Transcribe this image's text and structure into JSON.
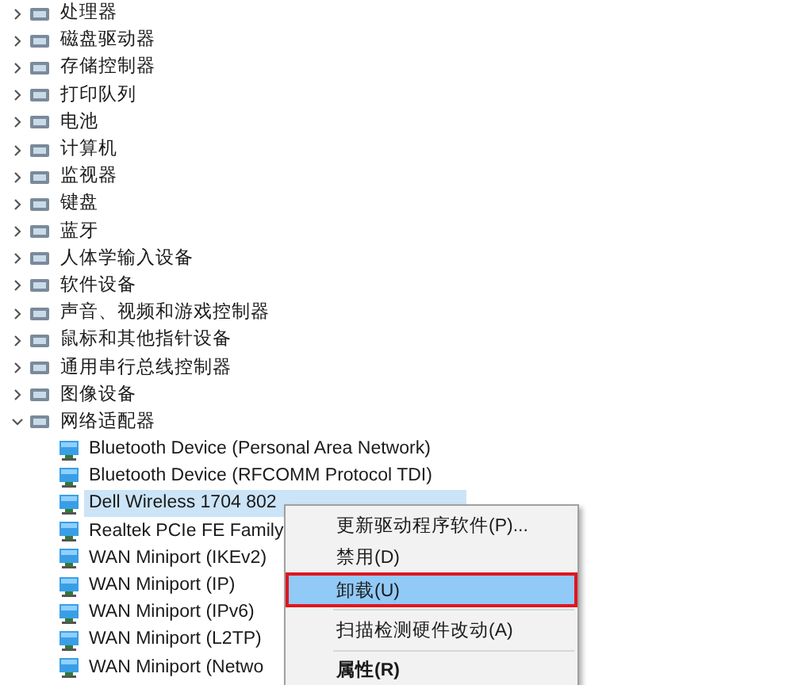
{
  "tree": [
    {
      "label": "处理器",
      "expanded": false
    },
    {
      "label": "磁盘驱动器",
      "expanded": false
    },
    {
      "label": "存储控制器",
      "expanded": false
    },
    {
      "label": "打印队列",
      "expanded": false
    },
    {
      "label": "电池",
      "expanded": false
    },
    {
      "label": "计算机",
      "expanded": false
    },
    {
      "label": "监视器",
      "expanded": false
    },
    {
      "label": "键盘",
      "expanded": false
    },
    {
      "label": "蓝牙",
      "expanded": false
    },
    {
      "label": "人体学输入设备",
      "expanded": false
    },
    {
      "label": "软件设备",
      "expanded": false
    },
    {
      "label": "声音、视频和游戏控制器",
      "expanded": false
    },
    {
      "label": "鼠标和其他指针设备",
      "expanded": false
    },
    {
      "label": "通用串行总线控制器",
      "expanded": false
    },
    {
      "label": "图像设备",
      "expanded": false
    },
    {
      "label": "网络适配器",
      "expanded": true,
      "children": [
        {
          "label": "Bluetooth Device (Personal Area Network)",
          "selected": false
        },
        {
          "label": "Bluetooth Device (RFCOMM Protocol TDI)",
          "selected": false
        },
        {
          "label": "Dell Wireless 1704 802",
          "selected": true
        },
        {
          "label": "Realtek PCIe FE Family",
          "selected": false
        },
        {
          "label": "WAN Miniport (IKEv2)",
          "selected": false
        },
        {
          "label": "WAN Miniport (IP)",
          "selected": false
        },
        {
          "label": "WAN Miniport (IPv6)",
          "selected": false
        },
        {
          "label": "WAN Miniport (L2TP)",
          "selected": false
        },
        {
          "label": "WAN Miniport (Netwo",
          "selected": false
        }
      ]
    }
  ],
  "context_menu": [
    {
      "kind": "item",
      "label": "更新驱动程序软件(P)...",
      "selected": false,
      "default": false,
      "outlined": false
    },
    {
      "kind": "item",
      "label": "禁用(D)",
      "selected": false,
      "default": false,
      "outlined": false
    },
    {
      "kind": "item",
      "label": "卸载(U)",
      "selected": true,
      "default": false,
      "outlined": true
    },
    {
      "kind": "separator"
    },
    {
      "kind": "item",
      "label": "扫描检测硬件改动(A)",
      "selected": false,
      "default": false,
      "outlined": false
    },
    {
      "kind": "separator"
    },
    {
      "kind": "item",
      "label": "属性(R)",
      "selected": false,
      "default": true,
      "outlined": false
    }
  ]
}
